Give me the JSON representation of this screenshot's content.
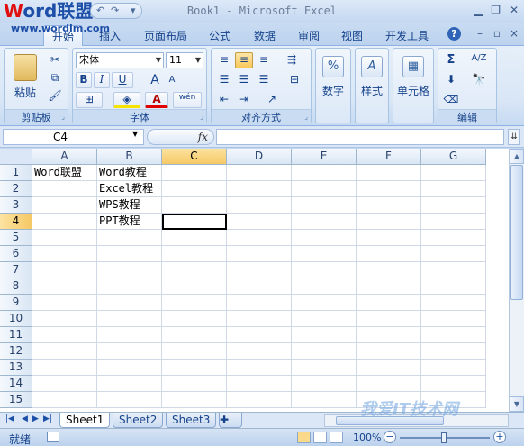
{
  "window": {
    "title": "Book1 - Microsoft Excel"
  },
  "logo": {
    "text_w": "W",
    "text_rest": "ord联盟",
    "url": "www.wordlm.com"
  },
  "tabs": [
    {
      "label": "开始",
      "active": true
    },
    {
      "label": "插入"
    },
    {
      "label": "页面布局"
    },
    {
      "label": "公式"
    },
    {
      "label": "数据"
    },
    {
      "label": "审阅"
    },
    {
      "label": "视图"
    },
    {
      "label": "开发工具"
    }
  ],
  "ribbon": {
    "clipboard": {
      "label": "剪贴板",
      "paste_label": "粘贴"
    },
    "font": {
      "label": "字体",
      "name": "宋体",
      "size": "11",
      "bold": "B",
      "italic": "I",
      "underline": "U",
      "grow": "A",
      "shrink": "A",
      "font_color": "A",
      "phonetic": "wén"
    },
    "alignment": {
      "label": "对齐方式"
    },
    "number": {
      "label": "数字",
      "icon": "%"
    },
    "styles": {
      "label": "样式",
      "icon": "A"
    },
    "cells": {
      "label": "单元格"
    },
    "editing": {
      "label": "编辑",
      "sum_icon": "Σ",
      "sort_icon": "A/Z"
    }
  },
  "formula_bar": {
    "name_box": "C4",
    "fx": "fx",
    "content": ""
  },
  "grid": {
    "columns": [
      "A",
      "B",
      "C",
      "D",
      "E",
      "F",
      "G"
    ],
    "rows": [
      "1",
      "2",
      "3",
      "4",
      "5",
      "6",
      "7",
      "8",
      "9",
      "10",
      "11",
      "12",
      "13",
      "14",
      "15"
    ],
    "active_cell": "C4",
    "cells": {
      "A1": "Word联盟",
      "B1": "Word教程",
      "B2": "Excel教程",
      "B3": "WPS教程",
      "B4": "PPT教程"
    }
  },
  "sheets": [
    {
      "name": "Sheet1",
      "active": true
    },
    {
      "name": "Sheet2"
    },
    {
      "name": "Sheet3"
    }
  ],
  "status": {
    "ready": "就绪",
    "zoom": "100%",
    "zoom_fraction": 0.5
  },
  "watermark": "我爱IT技术网",
  "colors": {
    "accent": "#15428b",
    "selection": "#f6c865",
    "ribbon_bg": "#dce8f7"
  }
}
